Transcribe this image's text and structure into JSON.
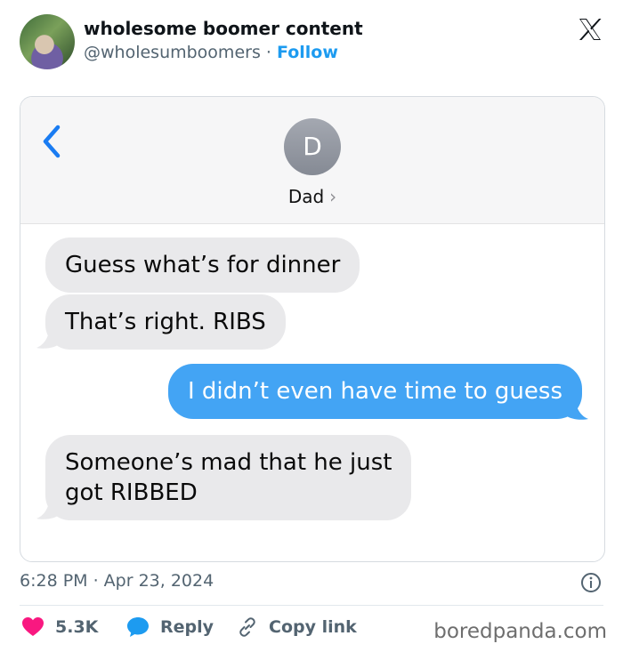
{
  "tweet": {
    "display_name": "wholesome boomer content",
    "handle": "@wholesumboomers",
    "separator": "·",
    "follow_label": "Follow",
    "timestamp": "6:28 PM · Apr 23, 2024",
    "likes": "5.3K",
    "reply_label": "Reply",
    "copy_label": "Copy link"
  },
  "conversation": {
    "contact_initial": "D",
    "contact_name": "Dad",
    "contact_chevron": "›",
    "messages": [
      {
        "direction": "in",
        "text": "Guess what’s for dinner"
      },
      {
        "direction": "in",
        "text": "That’s right. RIBS"
      },
      {
        "direction": "out",
        "text": "I didn’t even have time to guess"
      },
      {
        "direction": "in",
        "lines": [
          "Someone’s mad that he just",
          "got RIBBED"
        ]
      }
    ]
  },
  "watermark": "boredpanda.com",
  "colors": {
    "accent": "#1d9bf0",
    "like": "#f91880",
    "imessage_blue": "#43a4f4",
    "incoming_bubble": "#e9e9eb"
  },
  "icons": [
    "x-logo-icon",
    "back-chevron-icon",
    "info-icon",
    "heart-icon",
    "reply-bubble-icon",
    "link-icon"
  ]
}
